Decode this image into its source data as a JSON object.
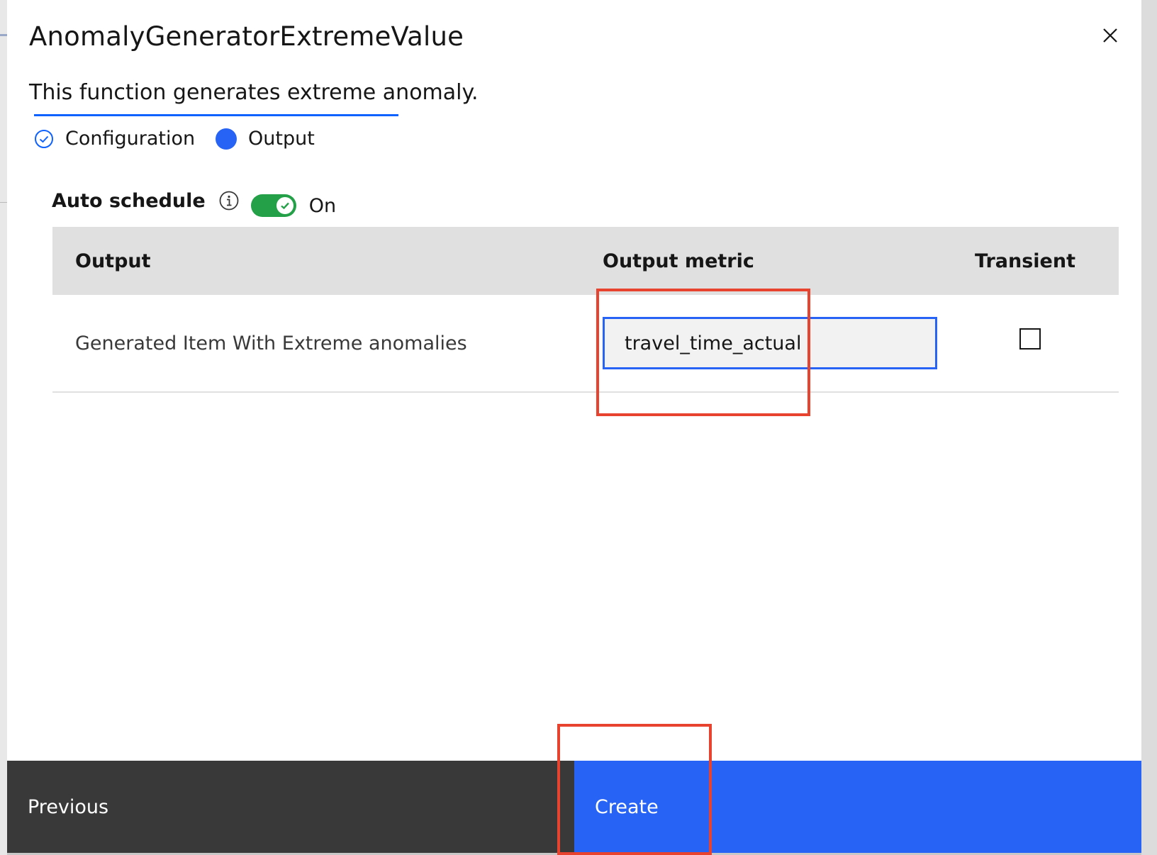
{
  "dialog": {
    "title": "AnomalyGeneratorExtremeValue",
    "description": "This function generates extreme anomaly.",
    "close_icon": "close-icon"
  },
  "steps": [
    {
      "label": "Configuration",
      "state": "complete",
      "icon": "checkmark-circle-icon"
    },
    {
      "label": "Output",
      "state": "current",
      "icon": "filled-circle-icon"
    }
  ],
  "schedule": {
    "label": "Auto schedule",
    "info_icon": "info-icon",
    "toggle_state": "On",
    "toggle_on": true
  },
  "table": {
    "headers": [
      "Output",
      "Output metric",
      "Transient"
    ],
    "rows": [
      {
        "output": "Generated Item With Extreme anomalies",
        "metric_value": "travel_time_actual",
        "transient": false
      }
    ]
  },
  "footer": {
    "previous_label": "Previous",
    "create_label": "Create"
  },
  "colors": {
    "primary": "#2764f5",
    "toggle_on": "#24a148",
    "footer_secondary": "#393939",
    "header_bg": "#e0e0e0",
    "annotation": "#e8432e"
  }
}
